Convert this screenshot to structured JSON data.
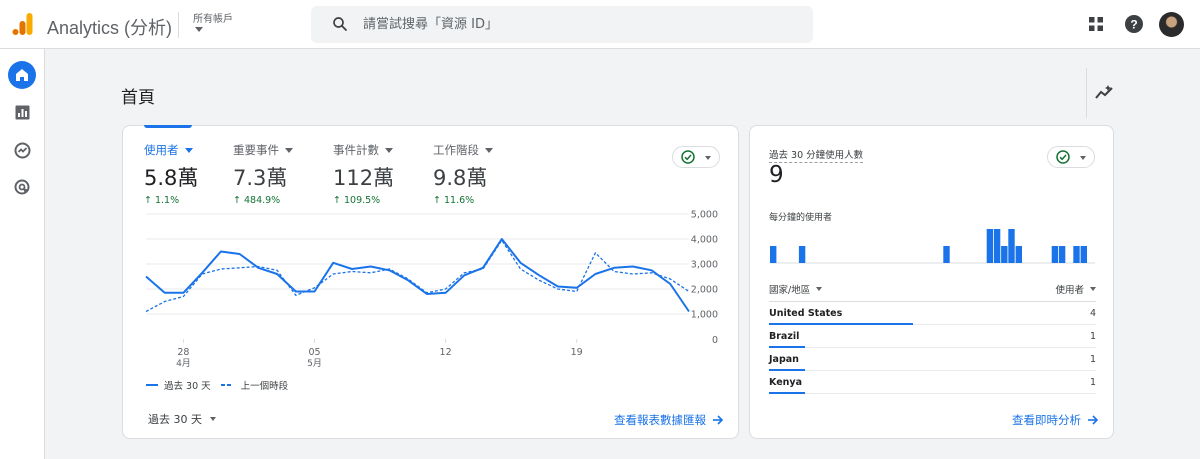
{
  "header": {
    "app_title": "Analytics (分析)",
    "account_label": "所有帳戶",
    "search_placeholder": "請嘗試搜尋「資源 ID」"
  },
  "icons": {
    "logo": "analytics-logo-icon",
    "search": "search-icon",
    "apps": "apps-grid-icon",
    "help": "help-icon",
    "home": "home-icon",
    "reports": "reports-icon",
    "explore": "explore-icon",
    "advertising": "advertising-icon",
    "insights": "insights-icon"
  },
  "colors": {
    "accent": "#1a73e8",
    "positive": "#137333",
    "logo_orange": "#f9ab00",
    "logo_dark_orange": "#e37400"
  },
  "page": {
    "title": "首頁"
  },
  "metrics": [
    {
      "label": "使用者",
      "value": "5.8萬",
      "delta": "1.1%",
      "active": true
    },
    {
      "label": "重要事件",
      "value": "7.3萬",
      "delta": "484.9%",
      "active": false
    },
    {
      "label": "事件計數",
      "value": "112萬",
      "delta": "109.5%",
      "active": false
    },
    {
      "label": "工作階段",
      "value": "9.8萬",
      "delta": "11.6%",
      "active": false
    }
  ],
  "chart_data": {
    "type": "line",
    "x_ticks": [
      {
        "index": 2,
        "day": "28",
        "month": "4月"
      },
      {
        "index": 9,
        "day": "05",
        "month": "5月"
      },
      {
        "index": 16,
        "day": "12",
        "month": ""
      },
      {
        "index": 23,
        "day": "19",
        "month": ""
      }
    ],
    "y_ticks": [
      "5,000",
      "4,000",
      "3,000",
      "2,000",
      "1,000",
      "0"
    ],
    "ylim": [
      0,
      5000
    ],
    "series": [
      {
        "name": "過去 30 天",
        "style": "solid",
        "values": [
          2500,
          1850,
          1850,
          2650,
          3500,
          3400,
          2850,
          2600,
          1900,
          1900,
          3050,
          2800,
          2900,
          2750,
          2350,
          1800,
          1850,
          2550,
          2850,
          4000,
          3050,
          2550,
          2100,
          2050,
          2600,
          2850,
          2900,
          2750,
          2200,
          1100
        ]
      },
      {
        "name": "上一個時段",
        "style": "dashed",
        "values": [
          1100,
          1500,
          1700,
          2600,
          2800,
          2850,
          2900,
          2750,
          1750,
          2050,
          2600,
          2700,
          2650,
          2800,
          2400,
          1850,
          2000,
          2650,
          2800,
          3950,
          2800,
          2350,
          2000,
          1900,
          3450,
          2700,
          2600,
          2650,
          2400,
          1900
        ]
      }
    ]
  },
  "main_card": {
    "legend_current": "過去 30 天",
    "legend_previous": "上一個時段",
    "range_label": "過去 30 天",
    "report_link": "查看報表數據匯報"
  },
  "realtime": {
    "title": "過去 30 分鐘使用人數",
    "value": "9",
    "per_minute_label": "每分鐘的使用者",
    "per_minute_values": [
      1,
      0,
      0,
      0,
      1,
      0,
      0,
      0,
      0,
      0,
      0,
      0,
      0,
      0,
      0,
      0,
      0,
      0,
      0,
      0,
      0,
      0,
      0,
      0,
      1,
      0,
      0,
      0,
      0,
      0,
      2,
      2,
      1,
      2,
      1,
      0,
      0,
      0,
      0,
      1,
      1,
      0,
      1,
      1,
      0
    ],
    "col_country": "國家/地區",
    "col_users": "使用者",
    "rows": [
      {
        "country": "United States",
        "value": "4",
        "share": 0.44
      },
      {
        "country": "Brazil",
        "value": "1",
        "share": 0.11
      },
      {
        "country": "Japan",
        "value": "1",
        "share": 0.11
      },
      {
        "country": "Kenya",
        "value": "1",
        "share": 0.11
      }
    ],
    "realtime_link": "查看即時分析"
  }
}
